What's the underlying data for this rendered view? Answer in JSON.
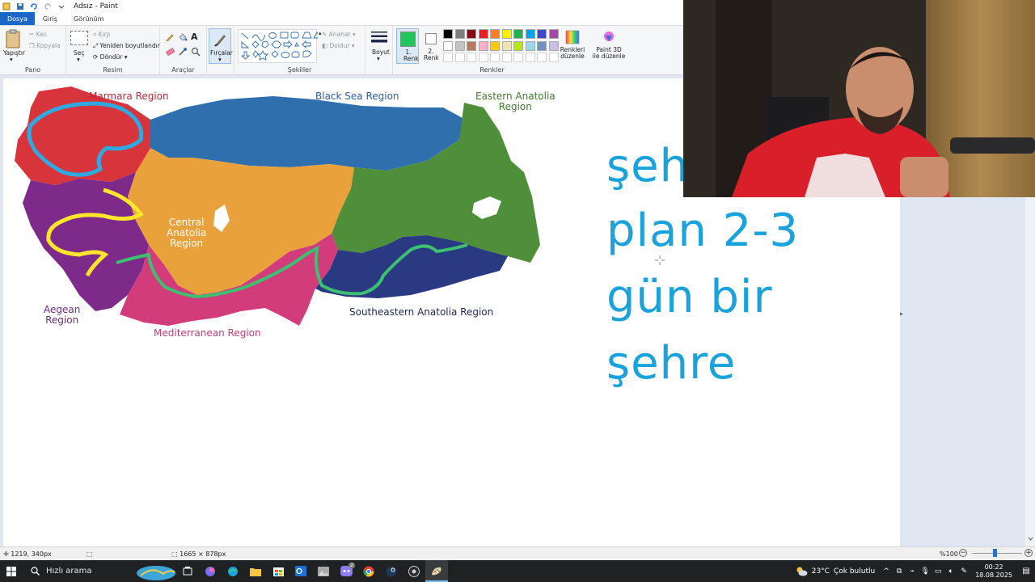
{
  "window": {
    "title": "Adsız - Paint"
  },
  "menu": {
    "tabs": [
      "Dosya",
      "Giriş",
      "Görünüm"
    ]
  },
  "ribbon": {
    "clipboard": {
      "paste": "Yapıştır",
      "cut": "Kes",
      "copy": "Kopyala",
      "label": "Pano"
    },
    "image": {
      "select": "Seç",
      "crop": "Kırp",
      "resize": "Yeniden boyutlandır",
      "rotate": "Döndür",
      "label": "Resim"
    },
    "tools": {
      "label": "Araçlar"
    },
    "brushes": {
      "label": "Fırçalar"
    },
    "shapes": {
      "outline": "Anahat",
      "fill": "Doldur",
      "label": "Şekiller"
    },
    "size": {
      "label": "Boyut"
    },
    "colors": {
      "color1": "1. Renk",
      "color2": "2. Renk",
      "edit_colors": "Renkleri düzenle",
      "paint3d": "Paint 3D ile düzenle",
      "label": "Renkler",
      "color1_value": "#22c55e",
      "color2_value": "#ffffff",
      "palette_row1": [
        "#000000",
        "#7f7f7f",
        "#880015",
        "#ed1c24",
        "#ff7f27",
        "#fff200",
        "#22b14c",
        "#00a2e8",
        "#3f48cc",
        "#a349a4"
      ],
      "palette_row2": [
        "#ffffff",
        "#c3c3c3",
        "#b97a57",
        "#ffaec9",
        "#ffc90e",
        "#efe4b0",
        "#b5e61d",
        "#99d9ea",
        "#7092be",
        "#c8bfe7"
      ]
    }
  },
  "map": {
    "regions": [
      {
        "name": "Marmara Region",
        "color": "#d8343c"
      },
      {
        "name": "Black Sea Region",
        "color": "#2f6fae"
      },
      {
        "name": "Eastern Anatolia Region",
        "color": "#4f8f3a"
      },
      {
        "name": "Central Anatolia Region",
        "color": "#e9a23b"
      },
      {
        "name": "Aegean Region",
        "color": "#7d2a8a"
      },
      {
        "name": "Mediterranean Region",
        "color": "#d33c7a"
      },
      {
        "name": "Southeastern Anatolia Region",
        "color": "#2a3a82"
      }
    ],
    "labels": {
      "marmara": "Marmara Region",
      "blacksea": "Black Sea Region",
      "eastern1": "Eastern Anatolia",
      "eastern2": "Region",
      "central1": "Central",
      "central2": "Anatolia",
      "central3": "Region",
      "aegean1": "Aegean",
      "aegean2": "Region",
      "mediterranean": "Mediterranean Region",
      "southeastern": "Southeastern Anatolia Region"
    }
  },
  "handwriting": {
    "line1": "şeh",
    "line2": "plan 2-3",
    "line3": "gün bir",
    "line4": "şehre"
  },
  "status": {
    "cursor": "1219, 340px",
    "canvas_size": "1665 × 878px",
    "zoom": "%100"
  },
  "taskbar": {
    "search": "Hızlı arama",
    "weather": "23°C",
    "weather_desc": "Çok bulutlu",
    "time": "00:22",
    "date": "18.08.2025",
    "badge": "2"
  }
}
